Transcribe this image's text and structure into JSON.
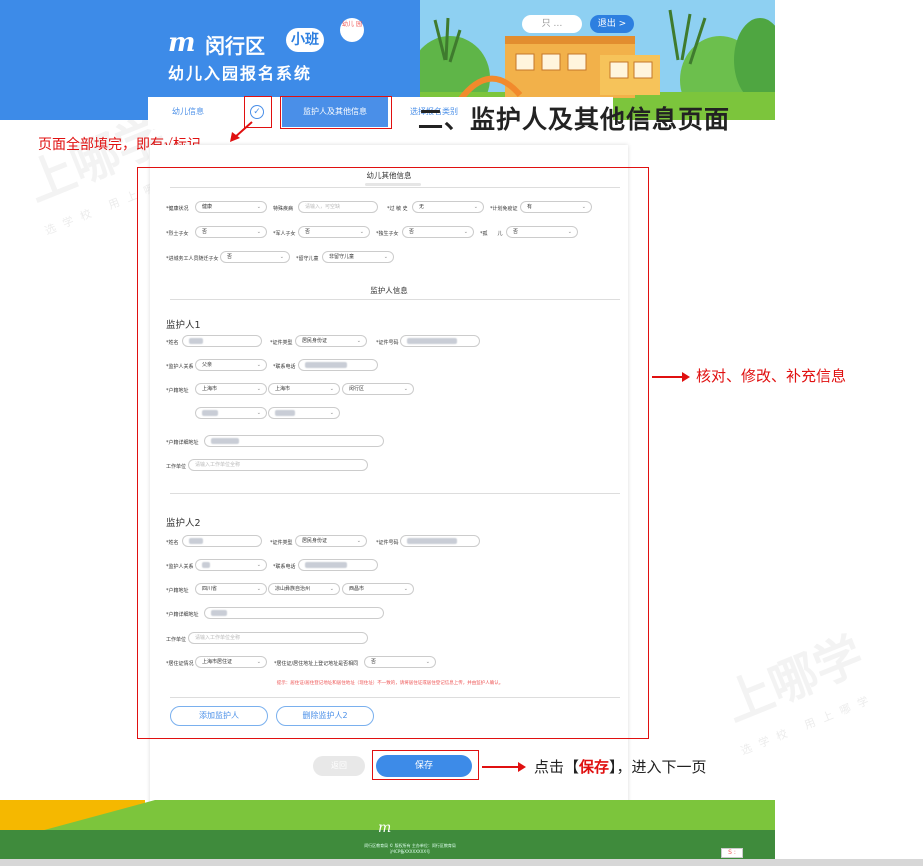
{
  "header": {
    "logo_mark": "m",
    "logo_title": "闵行区",
    "logo_badge": "小班",
    "logo_badge2": "幼儿 园",
    "logo_subtitle": "幼儿入园报名系统",
    "btn_1": "只 …",
    "btn_2": "退出 >",
    "bg_color": "#3d8be8"
  },
  "tabs": [
    {
      "label": "幼儿信息",
      "done": true,
      "check": "✓"
    },
    {
      "label": "监护人及其他信息",
      "active": true
    },
    {
      "label": "选择报名类别"
    }
  ],
  "annotations": {
    "page_title": "二、监护人及其他信息页面",
    "check_note": "页面全部填完，即有√标记",
    "right_note": "核对、修改、补充信息",
    "save_prefix": "点击【",
    "save_bold": "保存",
    "save_suffix": "】，进入下一页"
  },
  "form": {
    "other_info": {
      "title": "幼儿其他信息",
      "health_label": "*健康状况",
      "health_value": "健康",
      "disease_label": "特殊疾病",
      "disease_placeholder": "请输入，可空缺",
      "allergy_label": "*过 敏 史",
      "allergy_value": "无",
      "vaccine_label": "*计划免疫证",
      "vaccine_value": "有",
      "martyr_label": "*烈士子女",
      "martyr_value": "否",
      "soldier_label": "*军人子女",
      "soldier_value": "否",
      "only_label": "*独生子女",
      "only_value": "否",
      "orphan_label": "*孤　　儿",
      "orphan_value": "否",
      "worker_label": "*进城务工人员随迁子女",
      "worker_value": "否",
      "care_label": "*留守儿童",
      "care_value": "非留守儿童"
    },
    "guardian_section_title": "监护人信息",
    "guardian1": {
      "title": "监护人1",
      "name_label": "*姓名",
      "id_type_label": "*证件类型",
      "id_type_value": "居民身份证",
      "id_no_label": "*证件号码",
      "relation_label": "*监护人关系",
      "relation_value": "父亲",
      "phone_label": "*联系电话",
      "hukou_label": "*户籍地址",
      "hukou_province": "上海市",
      "hukou_city": "上海市",
      "hukou_district": "闵行区",
      "hukou_detail_label": "*户籍详细地址",
      "work_label": "工作单位",
      "work_placeholder": "请输入工作单位全称"
    },
    "guardian2": {
      "title": "监护人2",
      "name_label": "*姓名",
      "id_type_label": "*证件类型",
      "id_type_value": "居民身份证",
      "id_no_label": "*证件号码",
      "relation_label": "*监护人关系",
      "phone_label": "*联系电话",
      "hukou_label": "*户籍地址",
      "hukou_province": "四川省",
      "hukou_city": "凉山彝族自治州",
      "hukou_district": "西昌市",
      "hukou_detail_label": "*户籍详细地址",
      "work_label": "工作单位",
      "work_placeholder": "请输入工作单位全称",
      "residence_label": "*居住证情况",
      "residence_value": "上海市居住证",
      "residence_same_label": "*居住证/居住地址上登记地址是否相同",
      "residence_same_value": "否",
      "warning": "提示：居住证/居住登记地址和居住地址（现住址）不一致的，请将居住证或居住登记信息上传，并由监护人确认。"
    },
    "add_guardian": "添加监护人",
    "remove_guardian": "删除监护人2",
    "back": "返回",
    "save": "保存"
  },
  "footer": {
    "mark": "m",
    "line1": "闵行区教育局 © 版权所有 主办单位：闵行区教育局",
    "line2": "沪ICP备XXXXXXXX号",
    "page_badge": "S :"
  },
  "watermark": {
    "text": "上哪学",
    "sub": "选学校 用上哪学"
  }
}
